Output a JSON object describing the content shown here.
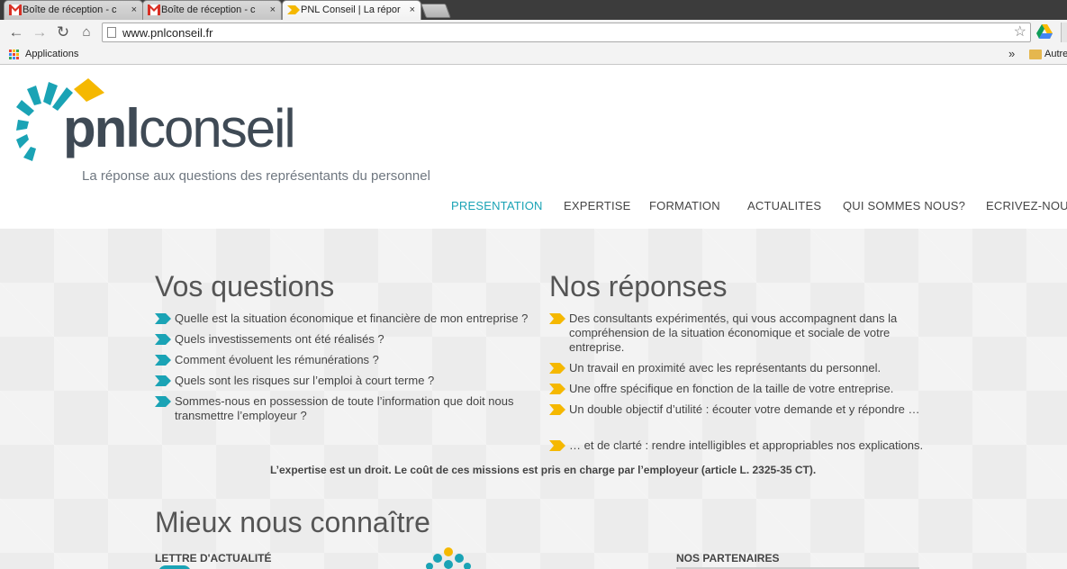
{
  "browser": {
    "tabs": [
      {
        "title": "Boîte de réception - c",
        "favicon": "gmail-icon"
      },
      {
        "title": "Boîte de réception - c",
        "favicon": "gmail-icon"
      },
      {
        "title": "PNL Conseil | La répor",
        "favicon": "pnl-icon"
      }
    ],
    "tab_close": "×",
    "url": "www.pnlconseil.fr",
    "bookmarks": {
      "apps_label": "Applications",
      "overflow": "»",
      "other_label": "Autre"
    }
  },
  "site": {
    "logo": {
      "word_bold": "pnl",
      "word_light": "conseil",
      "tagline": "La réponse aux questions des représentants du personnel"
    },
    "nav": [
      "PRESENTATION",
      "EXPERTISE",
      "FORMATION",
      "ACTUALITES",
      "QUI SOMMES NOUS?",
      "ECRIVEZ-NOUS"
    ],
    "colors": {
      "accent": "#1aa3b5",
      "gold": "#f5b800",
      "dark": "#3f4a55"
    },
    "questions": {
      "title": "Vos questions",
      "items": [
        "Quelle est la situation économique et financière de mon entreprise ?",
        "Quels investissements ont été réalisés ?",
        "Comment évoluent les rémunérations ?",
        "Quels sont les risques sur l’emploi à court terme ?",
        "Sommes-nous en possession de toute l’information que doit nous transmettre l’employeur ?"
      ]
    },
    "answers": {
      "title": "Nos réponses",
      "items": [
        "Des consultants expérimentés, qui vous accompagnent dans la compréhension de la situation économique et sociale de votre entreprise.",
        "Un travail en proximité avec les représentants du personnel.",
        "Une offre spécifique en fonction de la taille de votre entreprise.",
        "Un double objectif d’utilité : écouter votre demande et y répondre …",
        "… et de clarté : rendre intelligibles et appropriables nos explications."
      ]
    },
    "notice": "L’expertise est un droit. Le coût de ces missions est pris en charge par l’employeur (article L. 2325-35 CT).",
    "about": {
      "title": "Mieux nous connaître",
      "newsletter": "LETTRE D'ACTUALITÉ",
      "partners": "NOS PARTENAIRES"
    }
  }
}
